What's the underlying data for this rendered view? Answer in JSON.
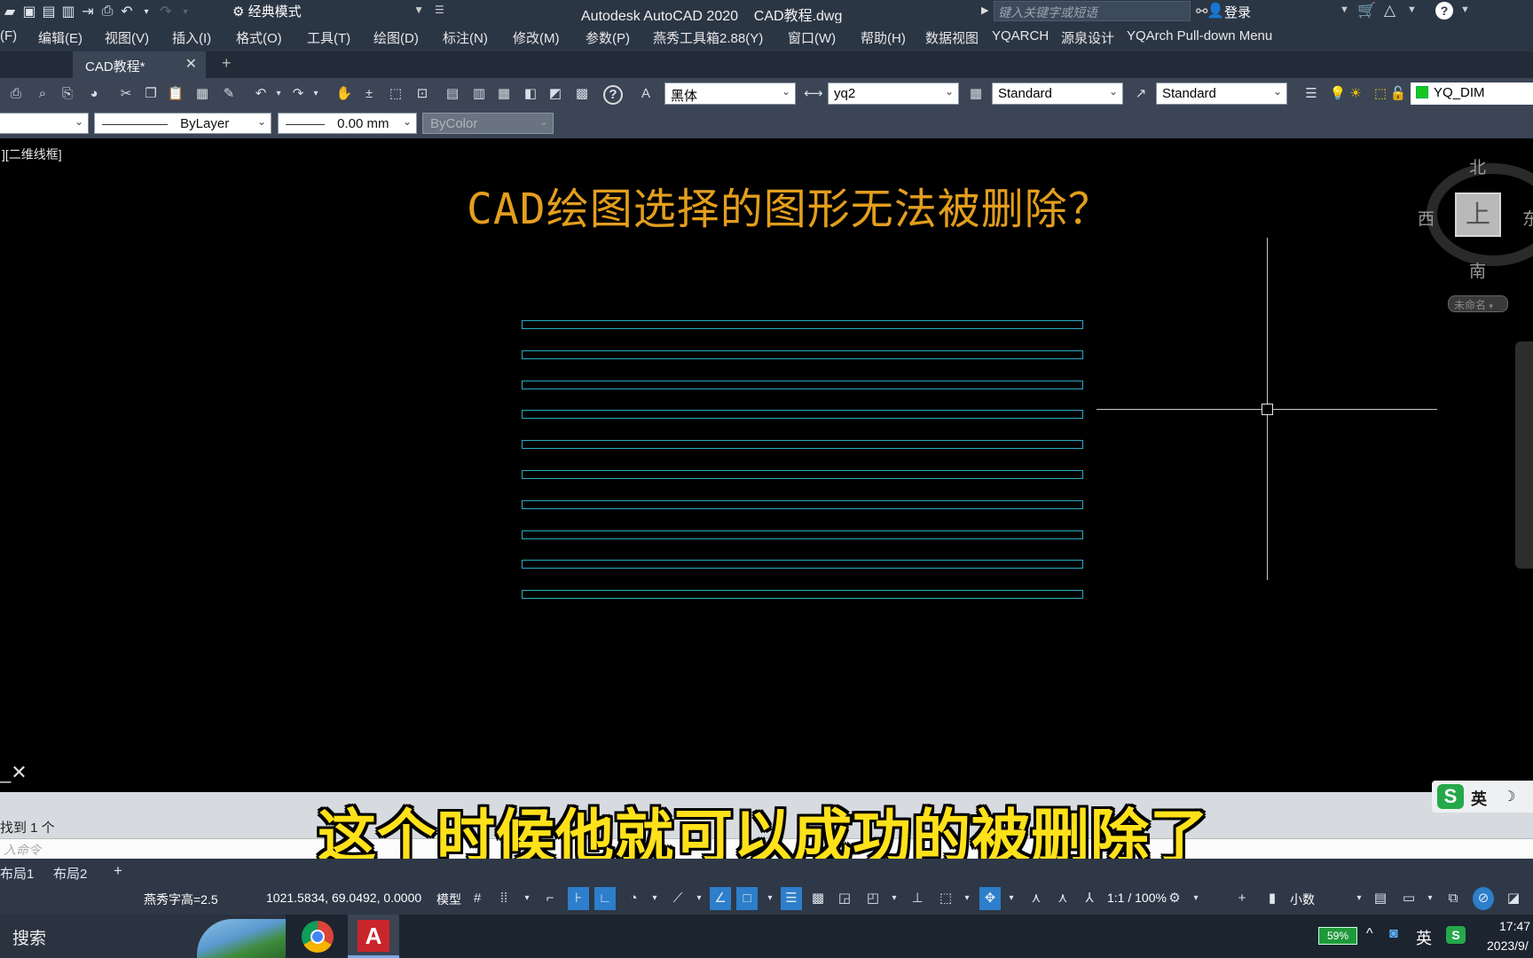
{
  "titlebar": {
    "workspace": "经典模式",
    "title": "Autodesk AutoCAD 2020    CAD教程.dwg",
    "search_placeholder": "键入关键字或短语",
    "login": "登录"
  },
  "menu": {
    "items": [
      "(F)",
      "编辑(E)",
      "视图(V)",
      "插入(I)",
      "格式(O)",
      "工具(T)",
      "绘图(D)",
      "标注(N)",
      "修改(M)",
      "参数(P)",
      "燕秀工具箱2.88(Y)",
      "窗口(W)",
      "帮助(H)",
      "数据视图",
      "YQARCH",
      "源泉设计",
      "YQArch Pull-down Menu"
    ]
  },
  "tabs": {
    "doc": "CAD教程*",
    "close": "✕",
    "new": "+"
  },
  "toolbar1": {
    "text_font": "黑体",
    "dim_style": "yq2",
    "table_style": "Standard",
    "multileader_style": "Standard",
    "layer": "YQ_DIM",
    "layer_color": "#16c81c"
  },
  "toolbar2": {
    "linetype": "ByLayer",
    "lineweight": "0.00 mm",
    "plot_style": "ByColor"
  },
  "canvas": {
    "viewport_label": "][二维线框]",
    "heading": "CAD绘图选择的图形无法被删除？",
    "heading_color": "#e39e1d",
    "rect_count": 10,
    "rect_color": "#2aa9bf"
  },
  "viewcube": {
    "north": "北",
    "south": "南",
    "west": "西",
    "east": "东",
    "face": "上",
    "ucs": "未命名"
  },
  "command": {
    "history": "找到 1 个",
    "input_placeholder": "入命令",
    "subtitle": "这个时候他就可以成功的被删除了"
  },
  "ime": {
    "logo": "S",
    "lang": "英"
  },
  "layout_tabs": [
    "布局1",
    "布局2",
    "+"
  ],
  "statusbar": {
    "font_height": "燕秀字高=2.5",
    "coords": "1021.5834, 69.0492, 0.0000",
    "model": "模型",
    "scale": "1:1 / 100%",
    "units": "小数"
  },
  "taskbar": {
    "search": "搜索",
    "app_label": "A",
    "battery": "59%",
    "lang": "英",
    "time": "17:47",
    "date": "2023/9/"
  }
}
